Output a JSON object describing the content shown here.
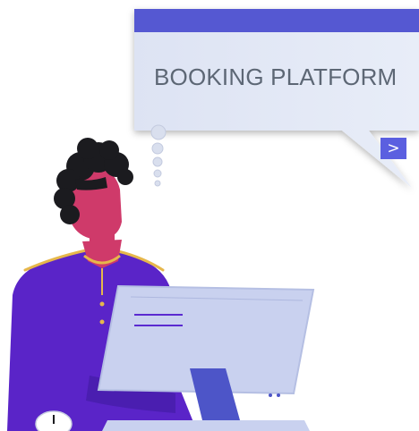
{
  "banner": {
    "title": "BOOKING PLATFORM",
    "next_button_glyph": ">"
  },
  "colors": {
    "banner_header": "#5558d2",
    "banner_body": "#e3e8f5",
    "next_button": "#5b5fe0",
    "skin": "#cf3a6a",
    "hair": "#1b1b1f",
    "uniform": "#5a24c8",
    "uniform_trim": "#e6b74b",
    "monitor_screen": "#c9d1ef",
    "monitor_stand": "#4d55c8",
    "screen_lines": "#5a2ad0"
  },
  "icons": {
    "next": "chevron-right-icon",
    "thought_bubbles": "thought-bubble-icon",
    "mouse": "mouse-icon"
  }
}
